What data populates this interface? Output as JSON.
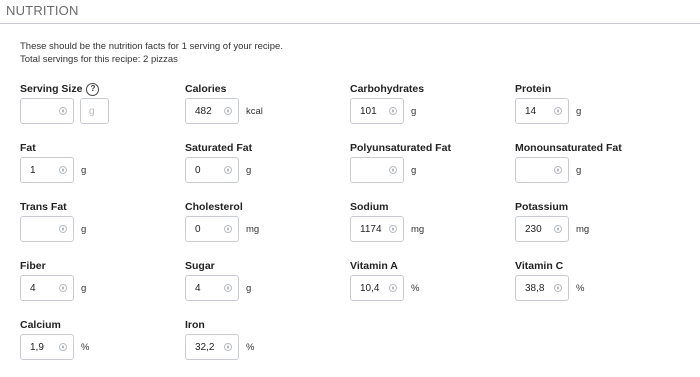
{
  "section": {
    "title": "NUTRITION"
  },
  "intro": {
    "line1": "These should be the nutrition facts for 1 serving of your recipe.",
    "line2": "Total servings for this recipe: 2 pizzas"
  },
  "serving_size": {
    "label": "Serving Size",
    "help": "?",
    "value": "",
    "unit_placeholder": "g"
  },
  "fields": [
    {
      "key": "calories",
      "label": "Calories",
      "value": "482",
      "unit": "kcal"
    },
    {
      "key": "carbohydrates",
      "label": "Carbohydrates",
      "value": "101",
      "unit": "g"
    },
    {
      "key": "protein",
      "label": "Protein",
      "value": "14",
      "unit": "g"
    },
    {
      "key": "fat",
      "label": "Fat",
      "value": "1",
      "unit": "g"
    },
    {
      "key": "saturated-fat",
      "label": "Saturated Fat",
      "value": "0",
      "unit": "g"
    },
    {
      "key": "polyunsaturated-fat",
      "label": "Polyunsaturated Fat",
      "value": "",
      "unit": "g"
    },
    {
      "key": "monounsaturated-fat",
      "label": "Monounsaturated Fat",
      "value": "",
      "unit": "g"
    },
    {
      "key": "trans-fat",
      "label": "Trans Fat",
      "value": "",
      "unit": "g"
    },
    {
      "key": "cholesterol",
      "label": "Cholesterol",
      "value": "0",
      "unit": "mg"
    },
    {
      "key": "sodium",
      "label": "Sodium",
      "value": "1174",
      "unit": "mg"
    },
    {
      "key": "potassium",
      "label": "Potassium",
      "value": "230",
      "unit": "mg"
    },
    {
      "key": "fiber",
      "label": "Fiber",
      "value": "4",
      "unit": "g"
    },
    {
      "key": "sugar",
      "label": "Sugar",
      "value": "4",
      "unit": "g"
    },
    {
      "key": "vitamin-a",
      "label": "Vitamin A",
      "value": "10,4",
      "unit": "%"
    },
    {
      "key": "vitamin-c",
      "label": "Vitamin C",
      "value": "38,8",
      "unit": "%"
    },
    {
      "key": "calcium",
      "label": "Calcium",
      "value": "1,9",
      "unit": "%"
    },
    {
      "key": "iron",
      "label": "Iron",
      "value": "32,2",
      "unit": "%"
    }
  ]
}
